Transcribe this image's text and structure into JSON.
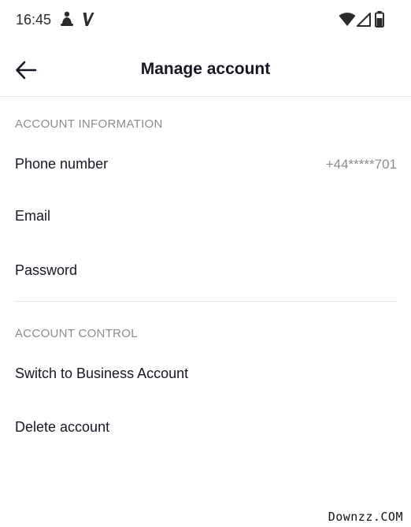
{
  "status_bar": {
    "time": "16:45",
    "icons": [
      "notification-icon",
      "app-v-icon",
      "wifi-icon",
      "signal-icon",
      "battery-icon"
    ]
  },
  "header": {
    "back_icon": "arrow-left-icon",
    "title": "Manage account"
  },
  "account_information": {
    "heading": "ACCOUNT INFORMATION",
    "items": [
      {
        "label": "Phone number",
        "value": "+44*****701"
      },
      {
        "label": "Email",
        "value": ""
      },
      {
        "label": "Password",
        "value": ""
      }
    ]
  },
  "account_control": {
    "heading": "ACCOUNT CONTROL",
    "items": [
      {
        "label": "Switch to Business Account"
      },
      {
        "label": "Delete account"
      }
    ]
  },
  "watermark": "Downzz.COM",
  "colors": {
    "primary_text": "#161823",
    "secondary_text": "#8a8b91",
    "divider": "#e6e6e8",
    "background": "#ffffff"
  }
}
